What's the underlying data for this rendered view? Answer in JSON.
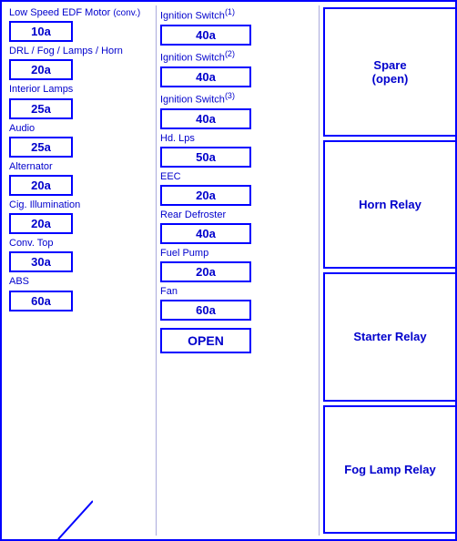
{
  "columns": {
    "left": {
      "items": [
        {
          "id": "low-speed-edf",
          "label": "Low Speed EDF Motor",
          "value": "10a",
          "note": "(conv.)"
        },
        {
          "id": "drl-fog",
          "label": "DRL / Fog / Lamps / Horn",
          "value": "20a",
          "note": ""
        },
        {
          "id": "interior-lamps",
          "label": "Interior Lamps",
          "value": "25a",
          "note": ""
        },
        {
          "id": "audio",
          "label": "Audio",
          "value": "25a",
          "note": ""
        },
        {
          "id": "alternator",
          "label": "Alternator",
          "value": "20a",
          "note": ""
        },
        {
          "id": "cig-illumination",
          "label": "Cig. Illumination",
          "value": "20a",
          "note": ""
        },
        {
          "id": "conv-top",
          "label": "Conv. Top",
          "value": "30a",
          "note": ""
        },
        {
          "id": "abs",
          "label": "ABS",
          "value": "60a",
          "note": ""
        }
      ]
    },
    "middle": {
      "items": [
        {
          "id": "ignition-1",
          "label": "Ignition Switch",
          "sup": "(1)",
          "value": "40a"
        },
        {
          "id": "ignition-2",
          "label": "Ignition Switch",
          "sup": "(2)",
          "value": "40a"
        },
        {
          "id": "ignition-3",
          "label": "Ignition Switch",
          "sup": "(3)",
          "value": "40a"
        },
        {
          "id": "hd-lps",
          "label": "Hd. Lps",
          "sup": "",
          "value": "50a"
        },
        {
          "id": "eec",
          "label": "EEC",
          "sup": "",
          "value": "20a"
        },
        {
          "id": "rear-defroster",
          "label": "Rear Defroster",
          "sup": "",
          "value": "40a"
        },
        {
          "id": "fuel-pump",
          "label": "Fuel Pump",
          "sup": "",
          "value": "20a"
        },
        {
          "id": "fan",
          "label": "Fan",
          "sup": "",
          "value": "60a"
        },
        {
          "id": "open",
          "label": "",
          "sup": "",
          "value": "OPEN"
        }
      ]
    },
    "right": {
      "relays": [
        {
          "id": "spare",
          "label": "Spare\n(open)"
        },
        {
          "id": "horn-relay",
          "label": "Horn Relay"
        },
        {
          "id": "starter-relay",
          "label": "Starter Relay"
        },
        {
          "id": "fog-lamp-relay",
          "label": "Fog Lamp Relay"
        }
      ]
    }
  }
}
